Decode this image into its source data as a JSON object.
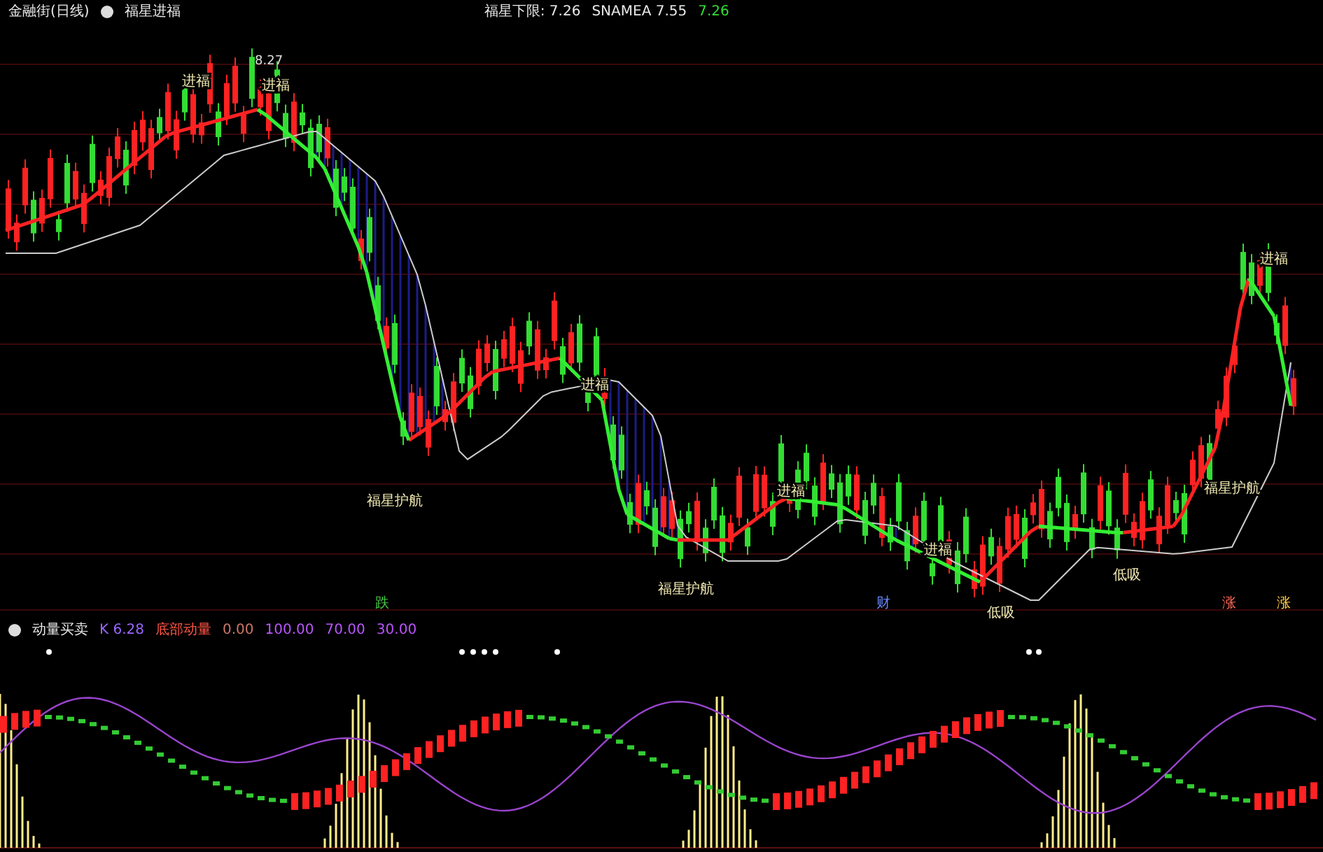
{
  "main_header": {
    "title": "金融街(日线)",
    "indicator": "福星进福",
    "readings": [
      {
        "label": "福星下限: 7.26",
        "color": "#e8e8e8"
      },
      {
        "label": "SNAMEA 7.55",
        "color": "#e8e8e8"
      },
      {
        "label": "7.26",
        "color": "#33dd33"
      }
    ]
  },
  "price_chart": {
    "peak_label": "8.27",
    "annotations": [
      {
        "text": "进福"
      },
      {
        "text": "进福"
      },
      {
        "text": "福星护航"
      },
      {
        "text": "进福"
      },
      {
        "text": "福星护航"
      },
      {
        "text": "进福"
      },
      {
        "text": "进福"
      },
      {
        "text": "低吸"
      },
      {
        "text": "低吸"
      },
      {
        "text": "福星护航"
      },
      {
        "text": "进福"
      }
    ],
    "markers": [
      {
        "text": "跌",
        "color": "#44cc44"
      },
      {
        "text": "财",
        "color": "#6688ff"
      },
      {
        "text": "涨",
        "color": "#ff6655"
      },
      {
        "text": "涨",
        "color": "#ffcc44"
      }
    ]
  },
  "indicator_header": {
    "title": "动量买卖",
    "readings": [
      {
        "label": "K 6.28",
        "color": "#9966ff"
      },
      {
        "label": "底部动量",
        "color": "#ff5544"
      },
      {
        "label": "0.00",
        "color": "#cc7766"
      },
      {
        "label": "100.00",
        "color": "#bb55ff"
      },
      {
        "label": "70.00",
        "color": "#bb55ff"
      },
      {
        "label": "30.00",
        "color": "#bb55ff"
      }
    ]
  }
}
